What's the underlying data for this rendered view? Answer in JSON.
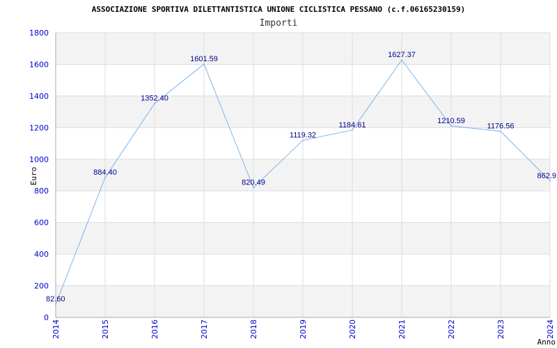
{
  "header": {
    "title": "ASSOCIAZIONE SPORTIVA DILETTANTISTICA UNIONE CICLISTICA PESSANO (c.f.06165230159)",
    "subtitle": "Importi"
  },
  "colors": {
    "line": "#7ab4ee",
    "band": "#f3f3f3",
    "grid": "#dddddd",
    "axis": "#aaaaaa",
    "tick_text": "#0000cc",
    "data_label": "#000088"
  },
  "chart_data": {
    "type": "line",
    "title": "ASSOCIAZIONE SPORTIVA DILETTANTISTICA UNIONE CICLISTICA PESSANO (c.f.06165230159)",
    "subtitle": "Importi",
    "xlabel": "Anno",
    "ylabel": "Euro",
    "ylim": [
      0,
      1800
    ],
    "yticks": [
      0,
      200,
      400,
      600,
      800,
      1000,
      1200,
      1400,
      1600,
      1800
    ],
    "grid": true,
    "categories": [
      "2014",
      "2015",
      "2016",
      "2017",
      "2018",
      "2019",
      "2020",
      "2021",
      "2022",
      "2023",
      "2024"
    ],
    "values": [
      82.6,
      884.4,
      1352.4,
      1601.59,
      820.49,
      1119.32,
      1184.61,
      1627.37,
      1210.59,
      1176.56,
      862.9
    ],
    "labels": [
      "82.60",
      "884.40",
      "1352.40",
      "1601.59",
      "820.49",
      "1119.32",
      "1184.61",
      "1627.37",
      "1210.59",
      "1176.56",
      "862.9"
    ]
  }
}
